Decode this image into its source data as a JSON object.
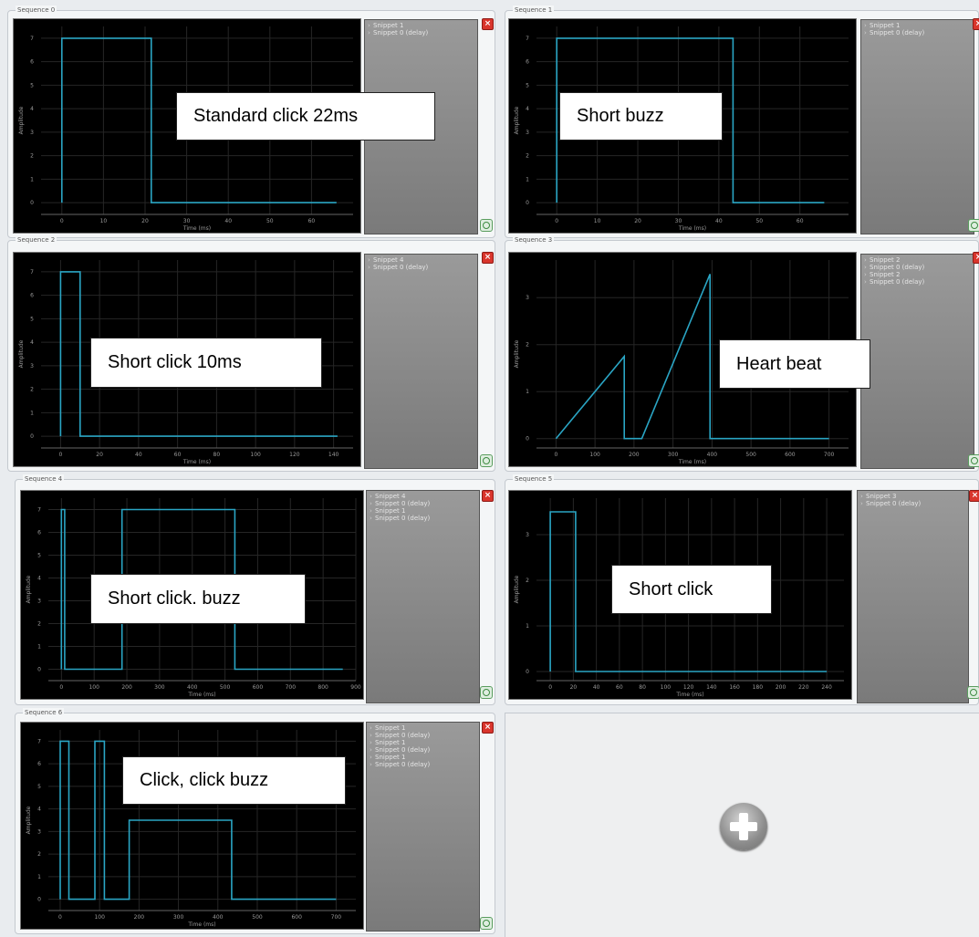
{
  "sequences": [
    {
      "title": "Sequence 0",
      "overlay_label": "Standard click 22ms",
      "snippets": [
        "Snippet 1",
        "Snippet 0 (delay)"
      ],
      "y_axis_label": "Amplitude",
      "x_axis_label": "Time (ms)",
      "chart_data": {
        "type": "line",
        "xlim": [
          -5,
          70
        ],
        "ylim": [
          -0.5,
          7.5
        ],
        "xticks": [
          0,
          10,
          20,
          30,
          40,
          50,
          60
        ],
        "yticks": [
          0,
          1,
          2,
          3,
          4,
          5,
          6,
          7
        ],
        "series": [
          {
            "x": [
              0,
              0,
              21.5,
              21.5,
              66
            ],
            "y": [
              0,
              7,
              7,
              0,
              0
            ]
          }
        ]
      }
    },
    {
      "title": "Sequence 1",
      "overlay_label": "Short buzz",
      "snippets": [
        "Snippet 1",
        "Snippet 0 (delay)"
      ],
      "y_axis_label": "Amplitude",
      "x_axis_label": "Time (ms)",
      "chart_data": {
        "type": "line",
        "xlim": [
          -5,
          72
        ],
        "ylim": [
          -0.5,
          7.5
        ],
        "xticks": [
          0,
          10,
          20,
          30,
          40,
          50,
          60
        ],
        "yticks": [
          0,
          1,
          2,
          3,
          4,
          5,
          6,
          7
        ],
        "series": [
          {
            "x": [
              0,
              0,
              43.5,
              43.5,
              66
            ],
            "y": [
              0,
              7,
              7,
              0,
              0
            ]
          }
        ]
      }
    },
    {
      "title": "Sequence 2",
      "overlay_label": "Short click 10ms",
      "snippets": [
        "Snippet 4",
        "Snippet 0 (delay)"
      ],
      "y_axis_label": "Amplitude",
      "x_axis_label": "Time (ms)",
      "chart_data": {
        "type": "line",
        "xlim": [
          -10,
          150
        ],
        "ylim": [
          -0.5,
          7.5
        ],
        "xticks": [
          0,
          20,
          40,
          60,
          80,
          100,
          120,
          140
        ],
        "yticks": [
          0,
          1,
          2,
          3,
          4,
          5,
          6,
          7
        ],
        "series": [
          {
            "x": [
              0,
              0,
              10,
              10,
              142
            ],
            "y": [
              0,
              7,
              7,
              0,
              0
            ]
          }
        ]
      }
    },
    {
      "title": "Sequence 3",
      "overlay_label": "Heart beat",
      "snippets": [
        "Snippet 2",
        "Snippet 0 (delay)",
        "Snippet 2",
        "Snippet 0 (delay)"
      ],
      "y_axis_label": "Amplitude",
      "x_axis_label": "Time (ms)",
      "chart_data": {
        "type": "line",
        "xlim": [
          -50,
          750
        ],
        "ylim": [
          -0.2,
          3.8
        ],
        "xticks": [
          0,
          100,
          200,
          300,
          400,
          500,
          600,
          700
        ],
        "yticks": [
          0,
          1,
          2,
          3
        ],
        "series": [
          {
            "x": [
              0,
              175,
              175,
              220,
              395,
              395,
              700
            ],
            "y": [
              0,
              1.75,
              0,
              0,
              3.5,
              0,
              0
            ]
          }
        ]
      }
    },
    {
      "title": "Sequence 4",
      "overlay_label": "Short click. buzz",
      "snippets": [
        "Snippet 4",
        "Snippet 0 (delay)",
        "Snippet 1",
        "Snippet 0 (delay)"
      ],
      "y_axis_label": "Amplitude",
      "x_axis_label": "Time (ms)",
      "chart_data": {
        "type": "line",
        "xlim": [
          -40,
          900
        ],
        "ylim": [
          -0.5,
          7.5
        ],
        "xticks": [
          0,
          100,
          200,
          300,
          400,
          500,
          600,
          700,
          800,
          900
        ],
        "yticks": [
          0,
          1,
          2,
          3,
          4,
          5,
          6,
          7
        ],
        "series": [
          {
            "x": [
              0,
              0,
              10,
              10,
              185,
              185,
              530,
              530,
              860
            ],
            "y": [
              0,
              7,
              7,
              0,
              0,
              7,
              7,
              0,
              0
            ]
          }
        ]
      }
    },
    {
      "title": "Sequence 5",
      "overlay_label": "Short click",
      "snippets": [
        "Snippet 3",
        "Snippet 0 (delay)"
      ],
      "y_axis_label": "Amplitude",
      "x_axis_label": "Time (ms)",
      "chart_data": {
        "type": "line",
        "xlim": [
          -12,
          255
        ],
        "ylim": [
          -0.2,
          3.8
        ],
        "xticks": [
          0,
          20,
          40,
          60,
          80,
          100,
          120,
          140,
          160,
          180,
          200,
          220,
          240
        ],
        "yticks": [
          0,
          1,
          2,
          3
        ],
        "series": [
          {
            "x": [
              0,
              0,
              22,
              22,
              240
            ],
            "y": [
              0,
              3.5,
              3.5,
              0,
              0
            ]
          }
        ]
      }
    },
    {
      "title": "Sequence 6",
      "overlay_label": "Click, click buzz",
      "snippets": [
        "Snippet 1",
        "Snippet 0 (delay)",
        "Snippet 1",
        "Snippet 0 (delay)",
        "Snippet 1",
        "Snippet 0 (delay)"
      ],
      "y_axis_label": "Amplitude",
      "x_axis_label": "Time (ms)",
      "chart_data": {
        "type": "line",
        "xlim": [
          -30,
          750
        ],
        "ylim": [
          -0.5,
          7.5
        ],
        "xticks": [
          0,
          100,
          200,
          300,
          400,
          500,
          600,
          700
        ],
        "yticks": [
          0,
          1,
          2,
          3,
          4,
          5,
          6,
          7
        ],
        "series": [
          {
            "x": [
              0,
              0,
              22,
              22,
              88,
              88,
              112,
              112,
              175,
              175,
              435,
              435,
              700
            ],
            "y": [
              0,
              7,
              7,
              0,
              0,
              7,
              7,
              0,
              0,
              3.5,
              3.5,
              0,
              0
            ]
          }
        ]
      }
    }
  ],
  "close_icon": "close-icon",
  "confirm_icon": "confirm-icon",
  "add_icon": "add-sequence-icon"
}
